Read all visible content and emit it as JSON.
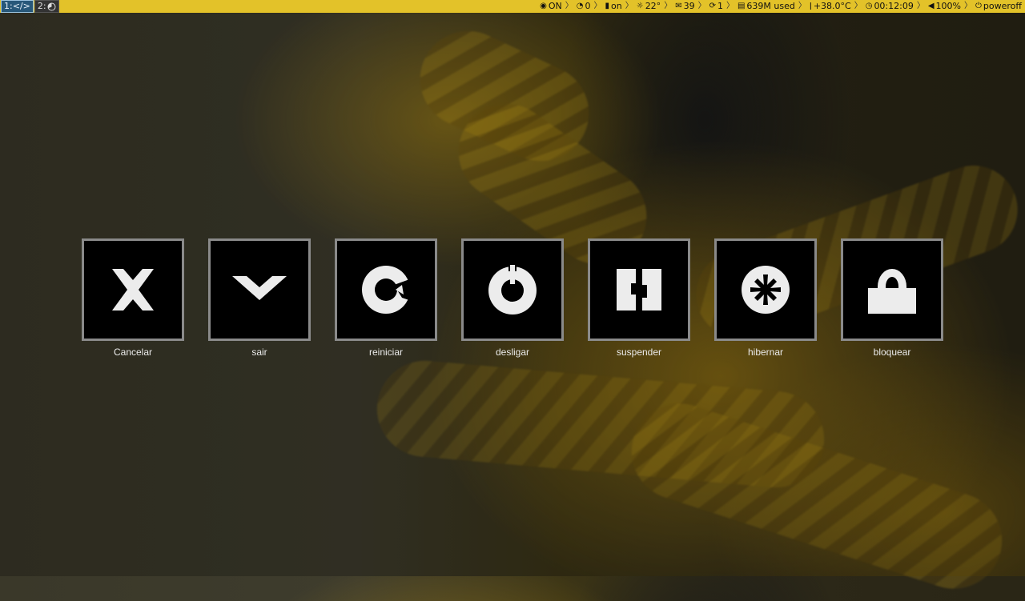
{
  "topbar": {
    "workspaces": [
      {
        "label": "1:</>",
        "active": true
      },
      {
        "label": "2:",
        "icon": "firefox-icon",
        "active": false
      }
    ],
    "status": [
      {
        "icon": "globe-icon",
        "text": "ON"
      },
      {
        "icon": "github-icon",
        "text": "0"
      },
      {
        "icon": "shield-icon",
        "text": "on"
      },
      {
        "icon": "sun-icon",
        "text": "22°"
      },
      {
        "icon": "mail-icon",
        "text": "39"
      },
      {
        "icon": "refresh-icon",
        "text": "1"
      },
      {
        "icon": "memory-icon",
        "text": "639M used"
      },
      {
        "icon": "thermometer-icon",
        "text": "+38.0°C"
      },
      {
        "icon": "clock-icon",
        "text": "00:12:09"
      },
      {
        "icon": "volume-icon",
        "text": "100%"
      },
      {
        "icon": "power-icon",
        "text": "poweroff"
      }
    ],
    "separator": "〉",
    "colors": {
      "bar": "#e3c229",
      "active_ws": "#28587a"
    }
  },
  "actions": [
    {
      "label": "Cancelar",
      "icon": "cancel-icon"
    },
    {
      "label": "sair",
      "icon": "logout-icon"
    },
    {
      "label": "reiniciar",
      "icon": "restart-icon"
    },
    {
      "label": "desligar",
      "icon": "shutdown-icon"
    },
    {
      "label": "suspender",
      "icon": "suspend-icon"
    },
    {
      "label": "hibernar",
      "icon": "hibernate-icon"
    },
    {
      "label": "bloquear",
      "icon": "lock-icon"
    }
  ]
}
